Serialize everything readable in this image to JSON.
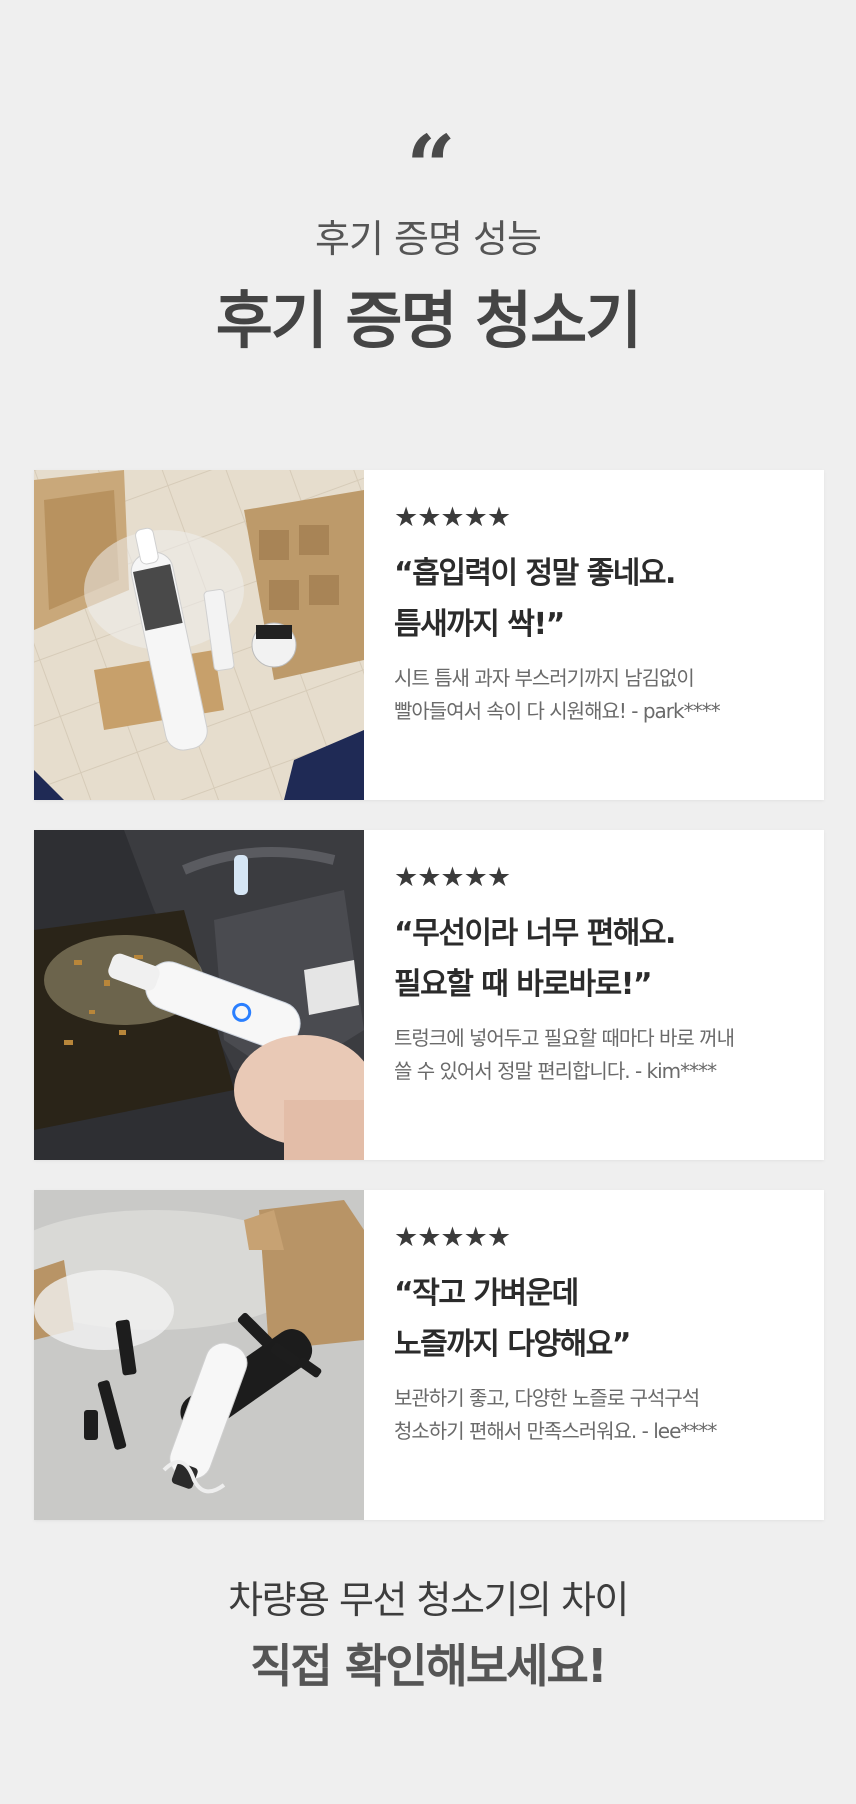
{
  "header": {
    "quote_mark": "“",
    "subtitle": "후기 증명 성능",
    "title": "후기 증명 청소기"
  },
  "reviews": [
    {
      "stars": "★★★★★",
      "rating": 5,
      "headline_line1": "“흡입력이 정말 좋네요.",
      "headline_line2": "틈새까지 싹!”",
      "body_line1": "시트 틈새 과자 부스러기까지 남김없이",
      "body_line2": "빨아들여서 속이 다 시원해요! - park****",
      "photo": "vacuum-unboxing-photo"
    },
    {
      "stars": "★★★★★",
      "rating": 5,
      "headline_line1": "“무선이라 너무 편해요.",
      "headline_line2": "필요할 때 바로바로!”",
      "body_line1": "트렁크에 넣어두고 필요할 때마다 바로 꺼내",
      "body_line2": "쓸 수 있어서 정말 편리합니다. - kim****",
      "photo": "car-seat-cleaning-photo"
    },
    {
      "stars": "★★★★★",
      "rating": 5,
      "headline_line1": "“작고 가벼운데",
      "headline_line2": "노즐까지 다양해요”",
      "body_line1": "보관하기 좋고, 다양한 노즐로 구석구석",
      "body_line2": "청소하기 편해서 만족스러워요. - lee****",
      "photo": "nozzle-set-photo"
    }
  ],
  "footer": {
    "line1": "차량용 무선 청소기의 차이",
    "line2": "직접 확인해보세요!"
  }
}
